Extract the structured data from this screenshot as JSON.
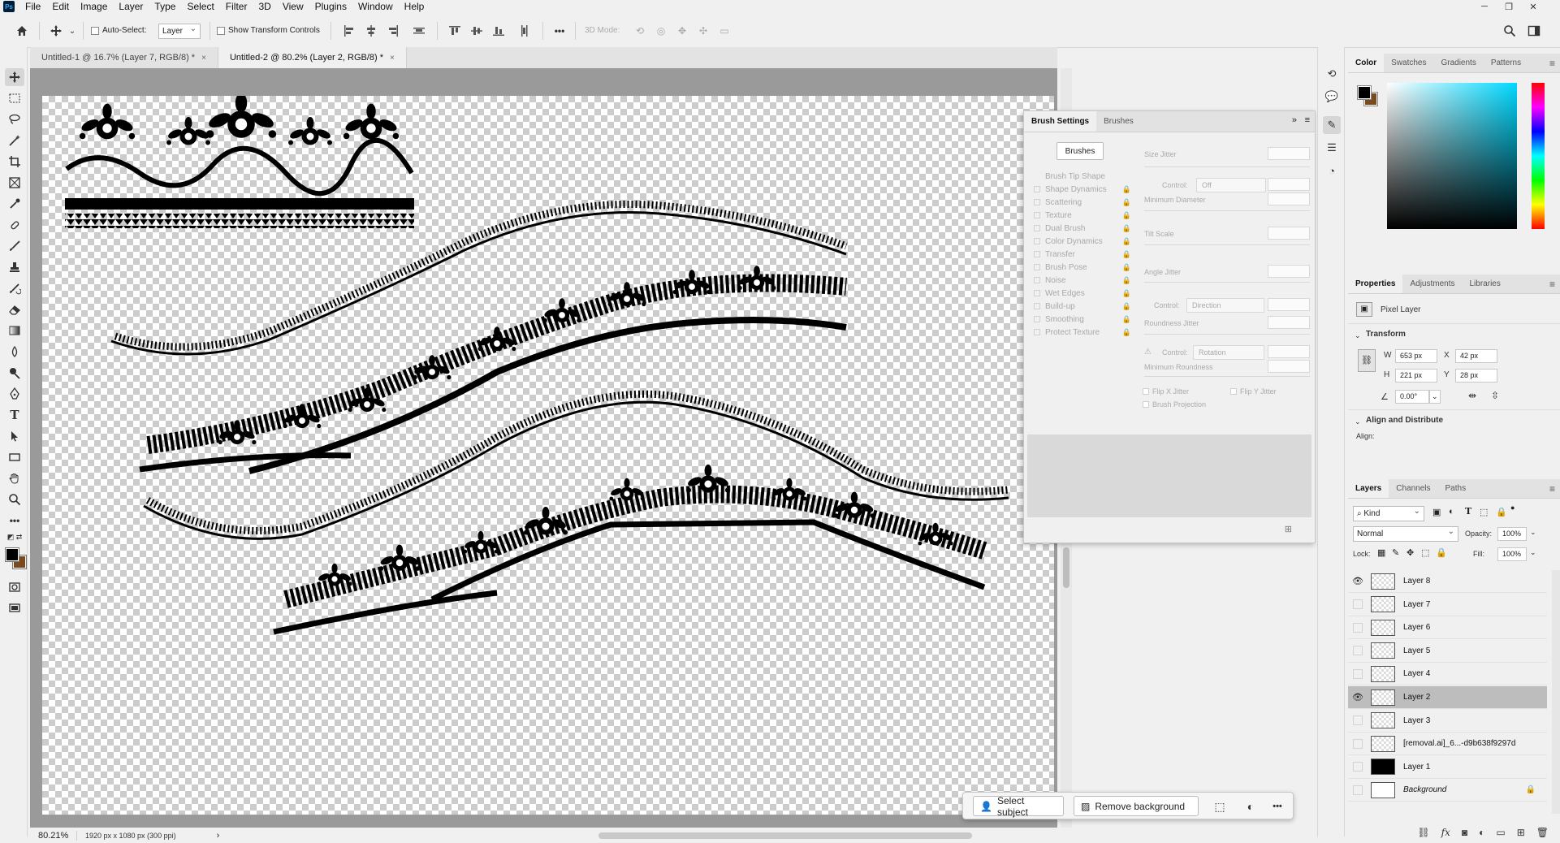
{
  "app": {
    "logo": "Ps"
  },
  "menu": [
    "File",
    "Edit",
    "Image",
    "Layer",
    "Type",
    "Select",
    "Filter",
    "3D",
    "View",
    "Plugins",
    "Window",
    "Help"
  ],
  "options": {
    "auto_select_label": "Auto-Select:",
    "auto_select_value": "Layer",
    "show_transform_label": "Show Transform Controls",
    "mode_3d_label": "3D Mode:",
    "more": "•••"
  },
  "tabs": [
    {
      "label": "Untitled-1 @ 16.7% (Layer 7, RGB/8) *",
      "close": "×"
    },
    {
      "label": "Untitled-2 @ 80.2% (Layer 2, RGB/8) *",
      "close": "×"
    }
  ],
  "status": {
    "zoom": "80.21%",
    "info": "1920 px x 1080 px (300 ppi)",
    "arrow": "›"
  },
  "taskbar": {
    "select_subject": "Select subject",
    "remove_background": "Remove background",
    "more": "•••"
  },
  "brush_panel": {
    "tabs": [
      "Brush Settings",
      "Brushes"
    ],
    "brushes_button": "Brushes",
    "items": [
      "Brush Tip Shape",
      "Shape Dynamics",
      "Scattering",
      "Texture",
      "Dual Brush",
      "Color Dynamics",
      "Transfer",
      "Brush Pose",
      "Noise",
      "Wet Edges",
      "Build-up",
      "Smoothing",
      "Protect Texture"
    ],
    "size_jitter": "Size Jitter",
    "control": "Control:",
    "control_off": "Off",
    "min_diameter": "Minimum Diameter",
    "tilt_scale": "Tilt Scale",
    "angle_jitter": "Angle Jitter",
    "control_direction": "Direction",
    "roundness_jitter": "Roundness Jitter",
    "control_rotation": "Rotation",
    "min_roundness": "Minimum Roundness",
    "flip_x": "Flip X Jitter",
    "flip_y": "Flip Y Jitter",
    "brush_projection": "Brush Projection"
  },
  "color_panel": {
    "tabs": [
      "Color",
      "Swatches",
      "Gradients",
      "Patterns"
    ],
    "foreground": "#000000",
    "background": "#7a4a1c",
    "hue": "#00d8ff"
  },
  "properties_panel": {
    "tabs": [
      "Properties",
      "Adjustments",
      "Libraries"
    ],
    "kind": "Pixel Layer",
    "transform_label": "Transform",
    "w_label": "W",
    "w_value": "653 px",
    "h_label": "H",
    "h_value": "221 px",
    "x_label": "X",
    "x_value": "42 px",
    "y_label": "Y",
    "y_value": "28 px",
    "angle_value": "0.00°",
    "align_label": "Align and Distribute",
    "align_sub": "Align:"
  },
  "layers_panel": {
    "tabs": [
      "Layers",
      "Channels",
      "Paths"
    ],
    "filter_kind": "Kind",
    "blend_mode": "Normal",
    "opacity_label": "Opacity:",
    "opacity_value": "100%",
    "lock_label": "Lock:",
    "fill_label": "Fill:",
    "fill_value": "100%",
    "layers": [
      {
        "name": "Layer 8",
        "visible": true,
        "selected": false,
        "thumb": "checker"
      },
      {
        "name": "Layer 7",
        "visible": false,
        "selected": false,
        "thumb": "checker"
      },
      {
        "name": "Layer 6",
        "visible": false,
        "selected": false,
        "thumb": "checker"
      },
      {
        "name": "Layer 5",
        "visible": false,
        "selected": false,
        "thumb": "checker"
      },
      {
        "name": "Layer 4",
        "visible": false,
        "selected": false,
        "thumb": "checker"
      },
      {
        "name": "Layer 2",
        "visible": true,
        "selected": true,
        "thumb": "checker"
      },
      {
        "name": "Layer 3",
        "visible": false,
        "selected": false,
        "thumb": "checker"
      },
      {
        "name": "[removal.ai]_6...-d9b638f9297d",
        "visible": false,
        "selected": false,
        "thumb": "checker"
      },
      {
        "name": "Layer 1",
        "visible": false,
        "selected": false,
        "thumb": "black"
      },
      {
        "name": "Background",
        "visible": false,
        "selected": false,
        "thumb": "white",
        "locked": true
      }
    ]
  }
}
